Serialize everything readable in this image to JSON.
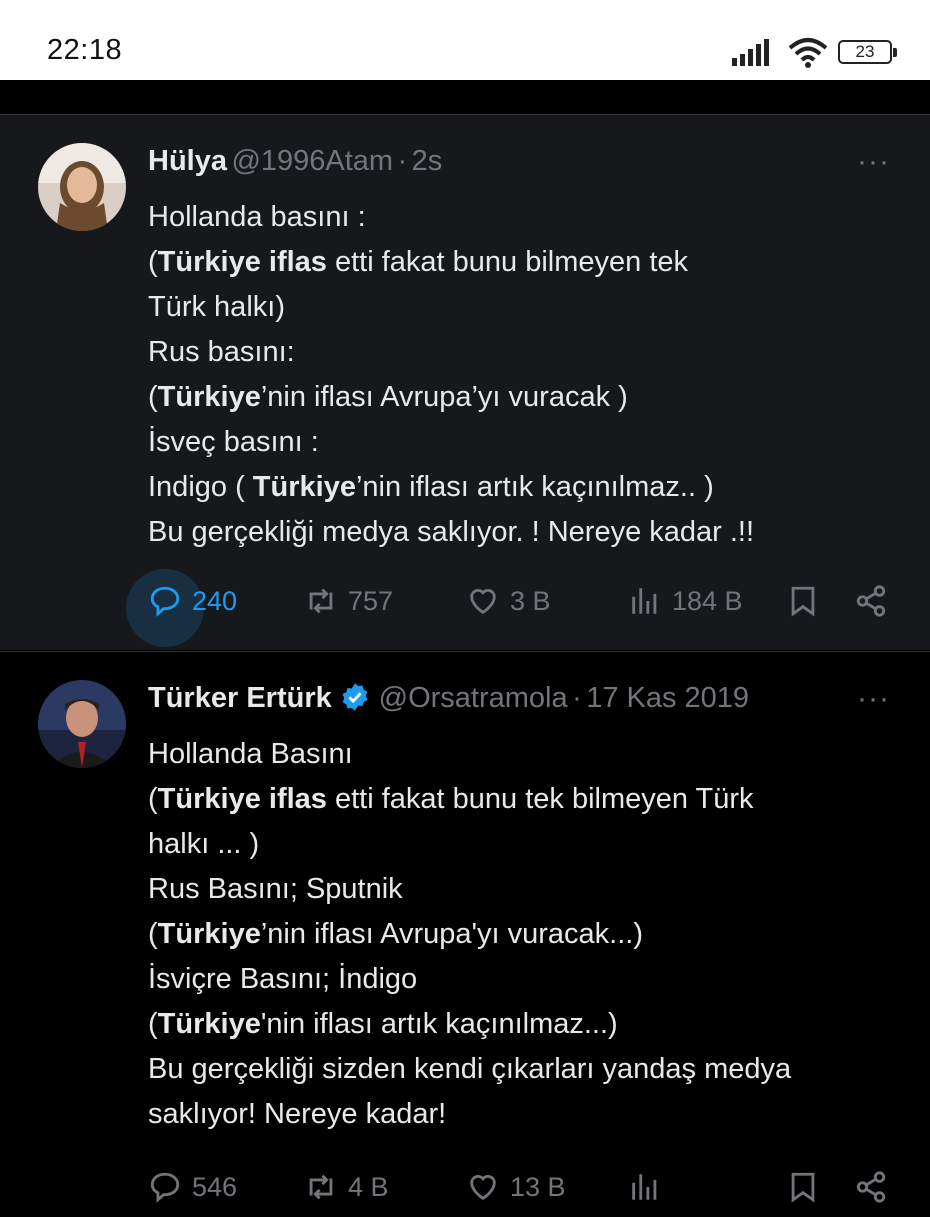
{
  "status_bar": {
    "time": "22:18",
    "battery": "23"
  },
  "tweets": [
    {
      "name": "Hülya",
      "handle": "@1996Atam",
      "separator": "·",
      "time": "2s",
      "more": "···",
      "lines": [
        [
          "Hollanda basını :"
        ],
        [
          "(",
          {
            "b": "Türkiye iflas"
          },
          " etti fakat bunu bilmeyen tek"
        ],
        [
          "Türk halkı)"
        ],
        [
          "Rus basını:"
        ],
        [
          "(",
          {
            "b": "Türkiye"
          },
          "’nin iflası Avrupa’yı vuracak )"
        ],
        [
          "İsveç basını :"
        ],
        [
          "Indigo ( ",
          {
            "b": "Türkiye"
          },
          "’nin iflası artık kaçınılmaz.. )"
        ],
        [
          "Bu gerçekliği medya saklıyor. ! Nereye kadar .!!"
        ]
      ],
      "stats": {
        "replies": "240",
        "retweets": "757",
        "likes": "3 B",
        "views": "184 B"
      },
      "reply_active": true
    },
    {
      "name": "Türker Ertürk",
      "handle": "@Orsatramola",
      "separator": "·",
      "time": "17 Kas 2019",
      "more": "···",
      "verified": true,
      "lines": [
        [
          "Hollanda Basını"
        ],
        [
          "(",
          {
            "b": "Türkiye iflas"
          },
          " etti fakat bunu tek bilmeyen Türk"
        ],
        [
          "halkı ... )"
        ],
        [
          "Rus Basını; Sputnik"
        ],
        [
          "(",
          {
            "b": "Türkiye"
          },
          "’nin iflası Avrupa'yı vuracak...)"
        ],
        [
          "İsviçre Basını; İndigo"
        ],
        [
          "(",
          {
            "b": "Türkiye"
          },
          "'nin iflası artık kaçınılmaz...)"
        ],
        [
          "Bu gerçekliği sizden kendi çıkarları yandaş medya"
        ],
        [
          "saklıyor! Nereye kadar!"
        ]
      ],
      "stats": {
        "replies": "546",
        "retweets": "4 B",
        "likes": "13 B",
        "views": ""
      }
    }
  ],
  "colors": {
    "accent": "#1d9bf0",
    "text": "#e7e9ea",
    "muted": "#71767b",
    "highlight_bg": "#16181c"
  },
  "icons": [
    "signal-icon",
    "wifi-icon",
    "battery-icon",
    "verified-badge-icon",
    "more-icon",
    "reply-icon",
    "retweet-icon",
    "like-icon",
    "views-icon",
    "bookmark-icon",
    "share-icon"
  ]
}
